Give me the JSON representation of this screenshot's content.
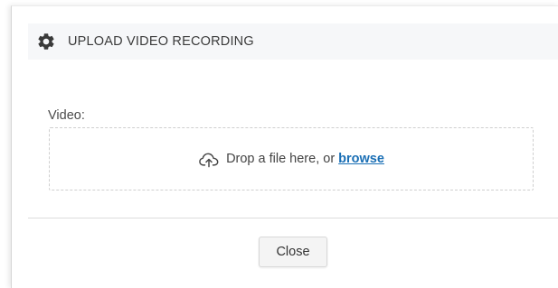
{
  "dialog": {
    "title": "UPLOAD VIDEO RECORDING",
    "title_icon": "gear-icon"
  },
  "video_field": {
    "label": "Video:",
    "dropzone_icon": "cloud-upload-icon",
    "dropzone_text": "Drop a file here, or",
    "browse_label": "browse"
  },
  "footer": {
    "close_label": "Close"
  },
  "colors": {
    "link": "#1a6fb5",
    "header_bg": "#f6f7f9",
    "text": "#333333"
  }
}
